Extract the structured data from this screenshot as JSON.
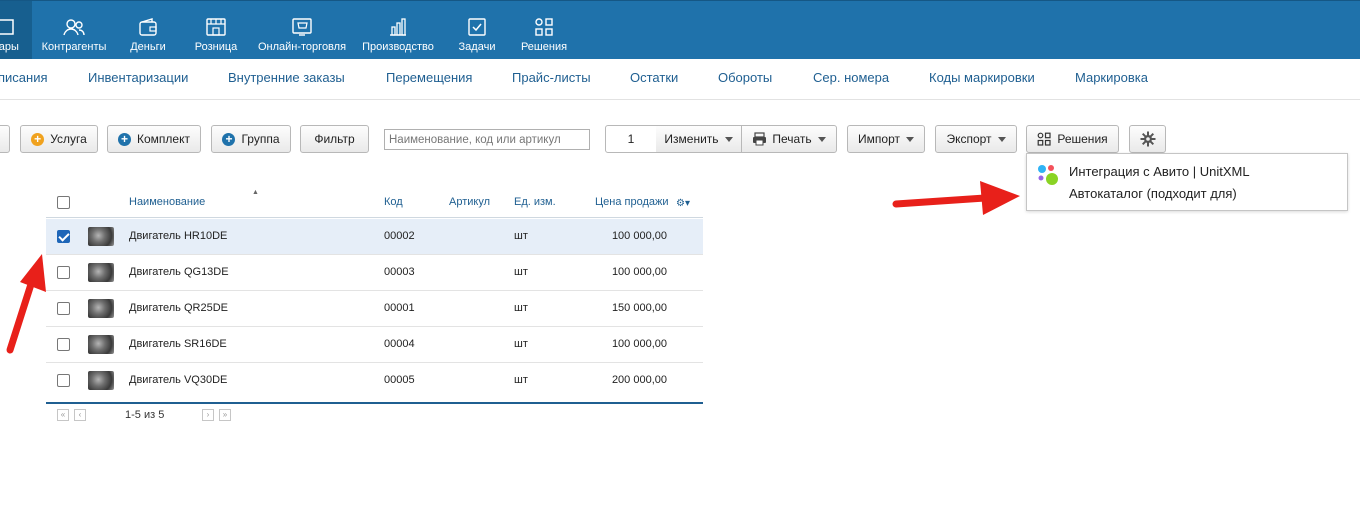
{
  "topnav": {
    "items": [
      {
        "label": "вары",
        "icon": "goods-icon"
      },
      {
        "label": "Контрагенты",
        "icon": "contacts-icon"
      },
      {
        "label": "Деньги",
        "icon": "wallet-icon"
      },
      {
        "label": "Розница",
        "icon": "store-icon"
      },
      {
        "label": "Онлайн-торговля",
        "icon": "online-shop-icon"
      },
      {
        "label": "Производство",
        "icon": "chart-bars-icon"
      },
      {
        "label": "Задачи",
        "icon": "task-check-icon"
      },
      {
        "label": "Решения",
        "icon": "apps-grid-icon"
      }
    ],
    "bg": "#1f72ab"
  },
  "subnav": {
    "items": [
      "писания",
      "Инвентаризации",
      "Внутренние заказы",
      "Перемещения",
      "Прайс-листы",
      "Остатки",
      "Обороты",
      "Сер. номера",
      "Коды маркировки",
      "Маркировка"
    ]
  },
  "toolbar": {
    "service_label": "Услуга",
    "bundle_label": "Комплект",
    "group_label": "Группа",
    "filter_label": "Фильтр",
    "search_placeholder": "Наименование, код или артикул",
    "qty_value": "1",
    "change_label": "Изменить",
    "print_label": "Печать",
    "import_label": "Импорт",
    "export_label": "Экспорт",
    "solutions_label": "Решения"
  },
  "table": {
    "headers": {
      "name": "Наименование",
      "code": "Код",
      "article": "Артикул",
      "unit": "Ед. изм.",
      "price": "Цена продажи"
    },
    "rows": [
      {
        "name": "Двигатель HR10DE",
        "code": "00002",
        "article": "",
        "unit": "шт",
        "price": "100 000,00",
        "checked": true
      },
      {
        "name": "Двигатель QG13DE",
        "code": "00003",
        "article": "",
        "unit": "шт",
        "price": "100 000,00",
        "checked": false
      },
      {
        "name": "Двигатель QR25DE",
        "code": "00001",
        "article": "",
        "unit": "шт",
        "price": "150 000,00",
        "checked": false
      },
      {
        "name": "Двигатель SR16DE",
        "code": "00004",
        "article": "",
        "unit": "шт",
        "price": "100 000,00",
        "checked": false
      },
      {
        "name": "Двигатель VQ30DE",
        "code": "00005",
        "article": "",
        "unit": "шт",
        "price": "200 000,00",
        "checked": false
      }
    ],
    "pagination": "1-5 из 5"
  },
  "dropdown": {
    "title": "Интеграция с Авито | UnitXML",
    "subtitle": "Автокаталог (подходит для)"
  },
  "colors": {
    "accent": "#1f72ab",
    "link": "#1f5f91",
    "arrow": "#e8201a",
    "selected_row": "#e6eef8"
  }
}
